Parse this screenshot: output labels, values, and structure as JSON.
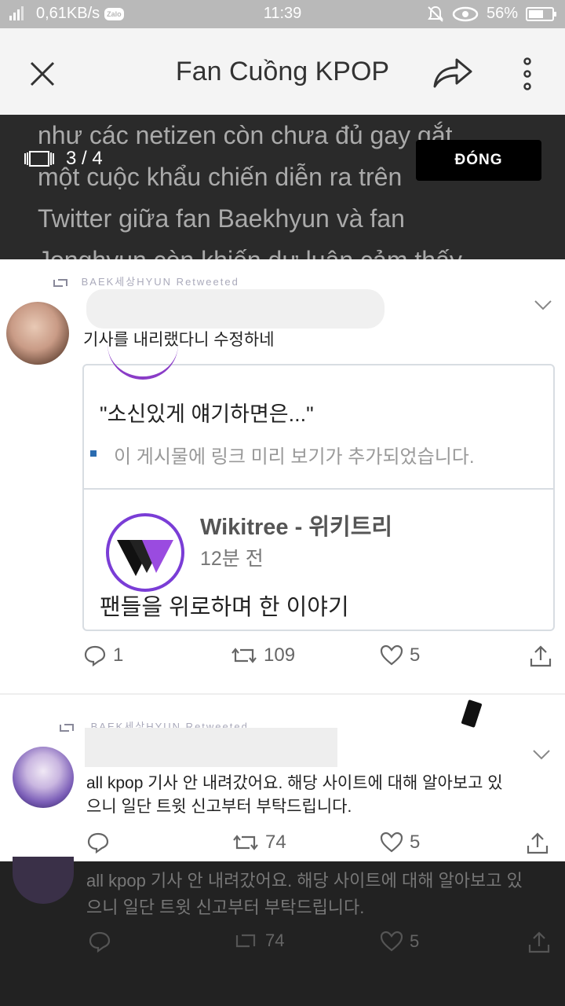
{
  "status_bar": {
    "network_speed": "0,61KB/s",
    "app_badge": "Zalo",
    "time": "11:39",
    "battery": "56%"
  },
  "appbar": {
    "title": "Fan Cuồng KPOP"
  },
  "viewer": {
    "counter": "3 / 4",
    "close_label": "ĐÓNG"
  },
  "background_article": {
    "lines": [
      "như các netizen còn chưa đủ gay gắt,",
      "một cuộc khẩu chiến diễn ra trên",
      "Twitter giữa fan Baekhyun và fan",
      "Jonghyun còn khiến dư luận cảm thấy"
    ],
    "bottom_text_line1": "all kpop 기사 안 내려갔어요. 해당 사이트에 대해 알아보고 있",
    "bottom_text_line2": "으니 일단 트윗 신고부터 부탁드립니다.",
    "bottom_retweets": "74",
    "bottom_likes": "5"
  },
  "tweet1": {
    "retweet_header": "BAEK세상HYUN Retweeted",
    "text": "기사를 내리랬다니 수정하네",
    "card_quote": "\"소신있게 얘기하면은...\"",
    "card_note": "이 게시물에 링크 미리 보기가 추가되었습니다.",
    "wiki_title": "Wikitree - 위키트리",
    "wiki_time": "12분 전",
    "headline": "팬들을 위로하며 한 이야기",
    "replies": "1",
    "retweets": "109",
    "likes": "5"
  },
  "tweet2": {
    "retweet_header": "BAEK세상HYUN Retweeted",
    "text_line1": "all kpop 기사 안 내려갔어요. 해당 사이트에 대해 알아보고 있",
    "text_line2": "으니 일단 트윗 신고부터 부탁드립니다.",
    "retweets": "74",
    "likes": "5"
  }
}
